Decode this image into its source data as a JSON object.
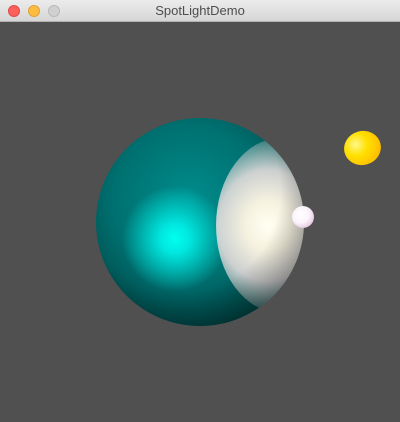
{
  "window": {
    "title": "SpotLightDemo",
    "controls": {
      "close": "close",
      "minimize": "minimize",
      "zoom": "zoom"
    }
  },
  "scene": {
    "background_color": "#505050",
    "objects": [
      {
        "name": "large-sphere",
        "color": "#00aaaa"
      },
      {
        "name": "spotlight-marker-sphere",
        "color": "#ffffff"
      },
      {
        "name": "light-sphere",
        "color": "#ffd000"
      }
    ]
  },
  "colors": {
    "close": "#fc605c",
    "minimize": "#fdbc40",
    "zoom": "#d0d0d0"
  }
}
